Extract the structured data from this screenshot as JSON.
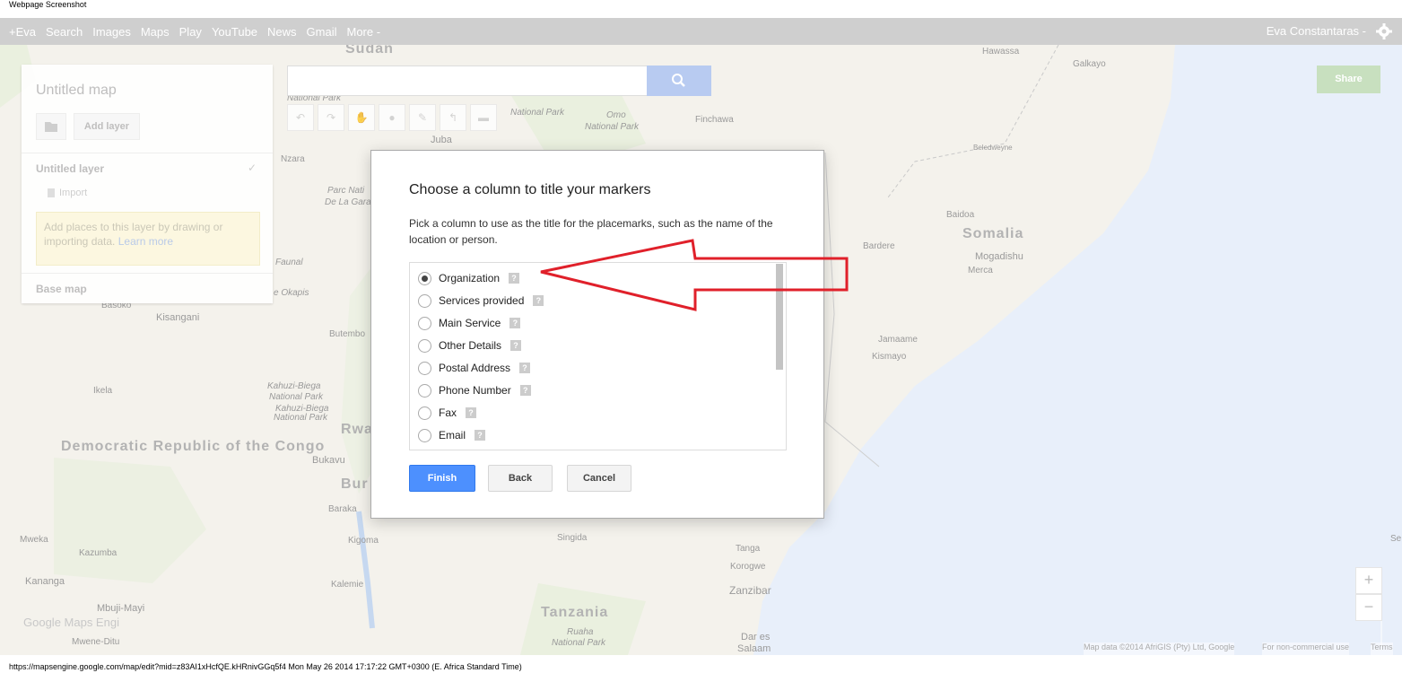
{
  "caption": "Webpage Screenshot",
  "topbar": {
    "nav": [
      "+Eva",
      "Search",
      "Images",
      "Maps",
      "Play",
      "YouTube",
      "News",
      "Gmail",
      "More -"
    ],
    "user": "Eva Constantaras -",
    "gear_icon": "gear-icon"
  },
  "left_panel": {
    "title": "Untitled map",
    "add_layer": "Add layer",
    "layer_name": "Untitled layer",
    "import": "Import",
    "hint": "Add places to this layer by drawing or importing data.",
    "learn_more": "Learn more",
    "base_map": "Base map"
  },
  "map_header": {
    "share": "Share"
  },
  "map_labels": {
    "sudan": "Sudan",
    "hawassa": "Hawassa",
    "galkayo": "Galkayo",
    "national_park_1": "National Park",
    "national_park_2": "National Park",
    "omo": "Omo",
    "national_park_3": "National Park",
    "finchawa": "Finchawa",
    "juba": "Juba",
    "nzara": "Nzara",
    "beledweyne": "Beledweyne",
    "parc_nati": "Parc Nati",
    "de_la_gara": "De La Gara",
    "baidoa": "Baidoa",
    "somalia": "Somalia",
    "bardere": "Bardere",
    "mogadishu": "Mogadishu",
    "merca": "Merca",
    "faunal": "Faunal",
    "okapis": "e Okapis",
    "basoko": "Basoko",
    "kisangani": "Kisangani",
    "butembo": "Butembo",
    "jamaame": "Jamaame",
    "kismayo": "Kismayo",
    "ikela": "Ikela",
    "kahuzi": "Kahuzi-Biega",
    "kahuzi_np": "National Park",
    "kahuzi2": "Kahuzi-Biega",
    "kahuzi2_np": "National Park",
    "drc": "Democratic Republic of the Congo",
    "rwa": "Rwa",
    "bukavu": "Bukavu",
    "bur": "Bur",
    "baraka": "Baraka",
    "kigoma": "Kigoma",
    "singida": "Singida",
    "tanga": "Tanga",
    "mweka": "Mweka",
    "kazumba": "Kazumba",
    "korogwe": "Korogwe",
    "zanzibar": "Zanzibar",
    "kananga": "Kananga",
    "kalemie": "Kalemie",
    "mbuji": "Mbuji-Mayi",
    "tanzania": "Tanzania",
    "ruaha": "Ruaha",
    "ruaha_np": "National Park",
    "dares": "Dar es",
    "salaam": "Salaam",
    "mwene": "Mwene-Ditu",
    "se": "Se",
    "watermark": "Google Maps Engi"
  },
  "attribution": {
    "map_data": "Map data ©2014 AfriGIS (Pty) Ltd, Google",
    "noncommercial": "For non-commercial use",
    "terms": "Terms"
  },
  "status_bar": "https://mapsengine.google.com/map/edit?mid=z83AI1xHcfQE.kHRnivGGq5f4 Mon May 26 2014 17:17:22 GMT+0300 (E. Africa Standard Time)",
  "dialog": {
    "title": "Choose a column to title your markers",
    "description": "Pick a column to use as the title for the placemarks, such as the name of the location or person.",
    "options": [
      "Organization",
      "Services provided",
      "Main Service",
      "Other Details",
      "Postal Address",
      "Phone Number",
      "Fax",
      "Email"
    ],
    "selected": "Organization",
    "help_glyph": "?",
    "finish": "Finish",
    "back": "Back",
    "cancel": "Cancel"
  },
  "colors": {
    "primary_button": "#4d90fe",
    "annotation_arrow": "#e0202a",
    "topbar": "#cfcfcf",
    "ocean": "#e8effa"
  }
}
